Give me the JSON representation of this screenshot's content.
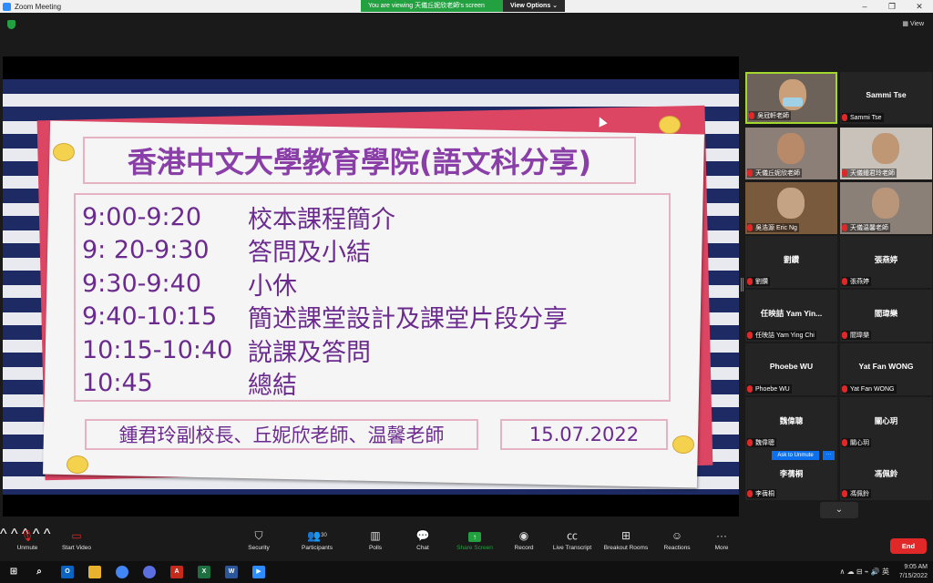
{
  "window": {
    "title": "Zoom Meeting",
    "minimize": "–",
    "restore": "❐",
    "close": "✕"
  },
  "banner": {
    "message": "You are viewing 天儀丘妮欣老師's screen",
    "options": "View Options ⌄"
  },
  "top": {
    "view_label": "View"
  },
  "slide": {
    "title": "香港中文大學教育學院(語文科分享)",
    "schedule": [
      {
        "time": "9:00-9:20",
        "item": "校本課程簡介"
      },
      {
        "time": "9: 20-9:30",
        "item": "答問及小結"
      },
      {
        "time": "9:30-9:40",
        "item": "小休"
      },
      {
        "time": "9:40-10:15",
        "item": "簡述課堂設計及課堂片段分享"
      },
      {
        "time": "10:15-10:40",
        "item": "說課及答問"
      },
      {
        "time": "10:45",
        "item": "總結"
      }
    ],
    "presenters": "鍾君玲副校長、丘妮欣老師、温馨老師",
    "date": "15.07.2022"
  },
  "gallery": {
    "tiles": [
      {
        "label": "吳冠軒老師",
        "big": ""
      },
      {
        "label": "Sammi Tse",
        "big": "Sammi Tse"
      },
      {
        "label": "天儀丘妮欣老師",
        "big": ""
      },
      {
        "label": "天儀鍾君玲老師",
        "big": ""
      },
      {
        "label": "吳浩源 Eric Ng",
        "big": ""
      },
      {
        "label": "天儀温馨老師",
        "big": ""
      },
      {
        "label": "劉鑽",
        "big": "劉鑽"
      },
      {
        "label": "張燕婷",
        "big": "張燕婷"
      },
      {
        "label": "任映詰 Yam Ying Chi",
        "big": "任映詰 Yam Yin..."
      },
      {
        "label": "閻瑋樂",
        "big": "閻瑋樂"
      },
      {
        "label": "Phoebe WU",
        "big": "Phoebe WU"
      },
      {
        "label": "Yat Fan WONG",
        "big": "Yat Fan WONG"
      },
      {
        "label": "魏偉聰",
        "big": "魏偉聰"
      },
      {
        "label": "關心玥",
        "big": "關心玥"
      },
      {
        "label": "李蒨桐",
        "big": "李蒨桐"
      },
      {
        "label": "馮佩鈴",
        "big": "馮佩鈴"
      }
    ],
    "ask_unmute": "Ask to Unmute",
    "ask_more": "···",
    "chevron": "⌄"
  },
  "toolbar": {
    "unmute": "Unmute",
    "start_video": "Start Video",
    "security": "Security",
    "participants": "Participants",
    "participants_count": "30",
    "polls": "Polls",
    "chat": "Chat",
    "share_screen": "Share Screen",
    "record": "Record",
    "live_transcript": "Live Transcript",
    "breakout_rooms": "Breakout Rooms",
    "reactions": "Reactions",
    "more": "More",
    "end": "End"
  },
  "taskbar": {
    "time": "9:05 AM",
    "date": "7/15/2022",
    "lang": "英",
    "tray": "∧ ☁ ⊟ ⌁ 🔊"
  }
}
